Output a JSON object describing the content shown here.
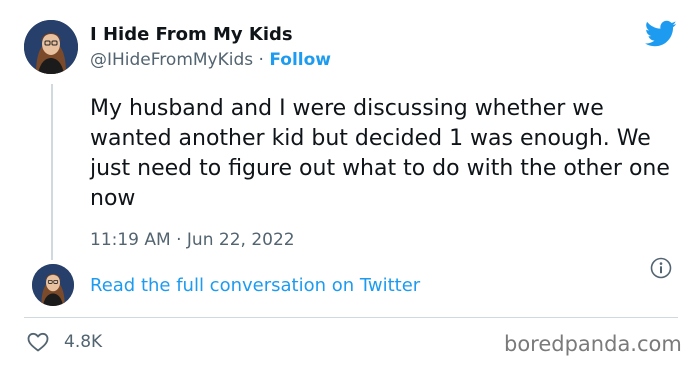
{
  "author": {
    "name": "I Hide From My Kids",
    "handle": "@IHideFromMyKids",
    "separator": "·",
    "follow_label": "Follow"
  },
  "tweet": {
    "text": "My husband and I were discussing whether we wanted another kid but decided 1 was enough. We just need to figure out what to do with the other one now",
    "time": "11:19 AM",
    "date": "Jun 22, 2022",
    "time_separator": "·"
  },
  "conversation": {
    "link_label": "Read the full conversation on Twitter"
  },
  "stats": {
    "likes": "4.8K"
  },
  "watermark": "boredpanda.com",
  "icons": {
    "brand": "twitter-bird-icon",
    "info": "info-icon",
    "like": "heart-icon"
  },
  "colors": {
    "accent": "#1d9bf0",
    "text": "#0f1419",
    "muted": "#536471",
    "divider": "#cfd9de"
  }
}
